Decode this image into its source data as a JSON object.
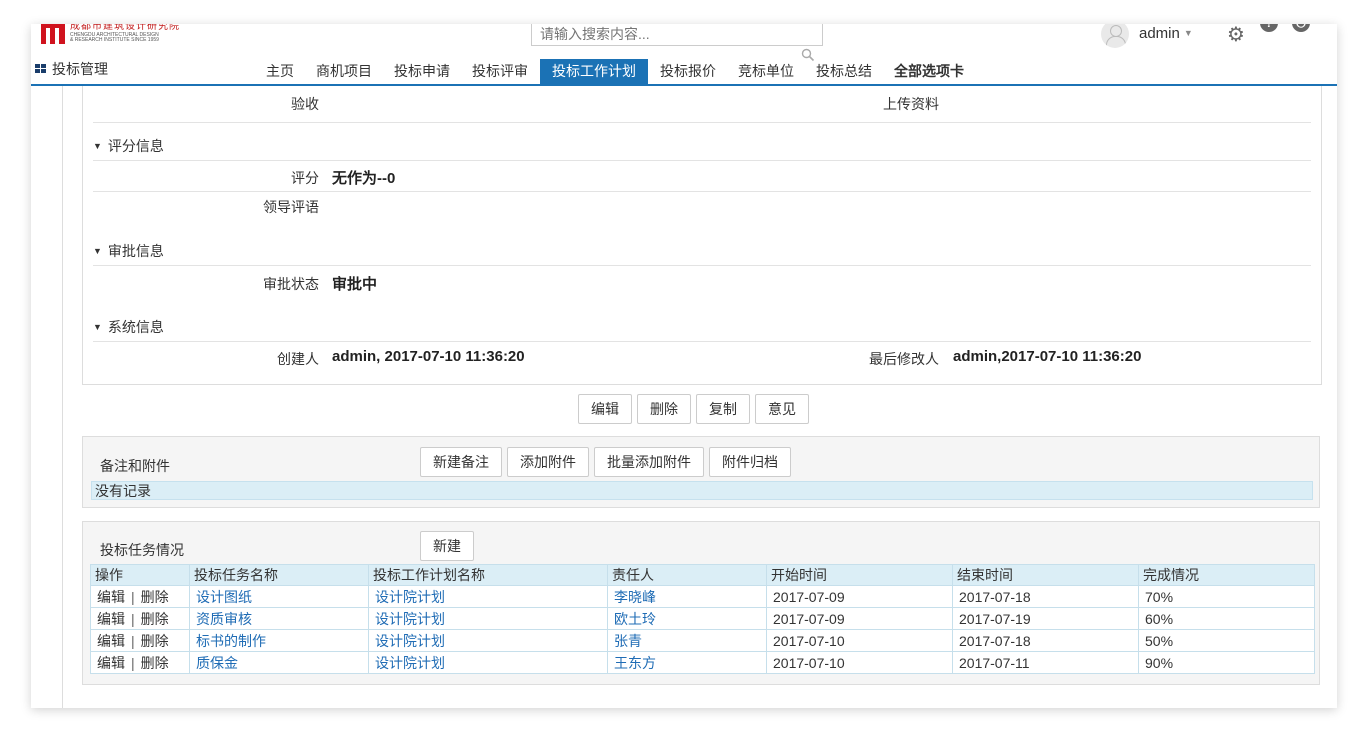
{
  "header": {
    "logo": {
      "cn": "成都市建筑设计研究院",
      "en": "CHENGDU ARCHITECTURAL DESIGN",
      "en2": "& RESEARCH INSTITUTE SINCE 1959"
    },
    "search_placeholder": "请输入搜索内容...",
    "username": "admin"
  },
  "nav": {
    "module": "投标管理",
    "tabs": [
      {
        "label": "主页"
      },
      {
        "label": "商机项目"
      },
      {
        "label": "投标申请"
      },
      {
        "label": "投标评审"
      },
      {
        "label": "投标工作计划",
        "active": true
      },
      {
        "label": "投标报价"
      },
      {
        "label": "竞标单位"
      },
      {
        "label": "投标总结"
      },
      {
        "label": "全部选项卡"
      }
    ]
  },
  "detail": {
    "acceptance_label": "验收",
    "upload_label": "上传资料",
    "score_section": "评分信息",
    "score_label": "评分",
    "score_value": "无作为--0",
    "leader_comment_label": "领导评语",
    "approval_section": "审批信息",
    "approval_status_label": "审批状态",
    "approval_status_value": "审批中",
    "system_section": "系统信息",
    "creator_label": "创建人",
    "creator_value": "admin, 2017-07-10 11:36:20",
    "modifier_label": "最后修改人",
    "modifier_value": "admin,2017-07-10 11:36:20"
  },
  "actions": {
    "edit": "编辑",
    "delete": "删除",
    "copy": "复制",
    "opinion": "意见"
  },
  "notes": {
    "title": "备注和附件",
    "new_note": "新建备注",
    "add_attachment": "添加附件",
    "batch_add": "批量添加附件",
    "archive": "附件归档",
    "empty": "没有记录"
  },
  "tasks": {
    "title": "投标任务情况",
    "new_button": "新建",
    "columns": [
      "操作",
      "投标任务名称",
      "投标工作计划名称",
      "责任人",
      "开始时间",
      "结束时间",
      "完成情况"
    ],
    "op_edit": "编辑",
    "op_sep": "|",
    "op_delete": "删除",
    "rows": [
      {
        "name": "设计图纸",
        "plan": "设计院计划",
        "owner": "李晓峰",
        "start": "2017-07-09",
        "end": "2017-07-18",
        "progress": "70%"
      },
      {
        "name": "资质审核",
        "plan": "设计院计划",
        "owner": "欧土玲",
        "start": "2017-07-09",
        "end": "2017-07-19",
        "progress": "60%"
      },
      {
        "name": "标书的制作",
        "plan": "设计院计划",
        "owner": "张青",
        "start": "2017-07-10",
        "end": "2017-07-18",
        "progress": "50%"
      },
      {
        "name": "质保金",
        "plan": "设计院计划",
        "owner": "王东方",
        "start": "2017-07-10",
        "end": "2017-07-11",
        "progress": "90%"
      }
    ]
  }
}
